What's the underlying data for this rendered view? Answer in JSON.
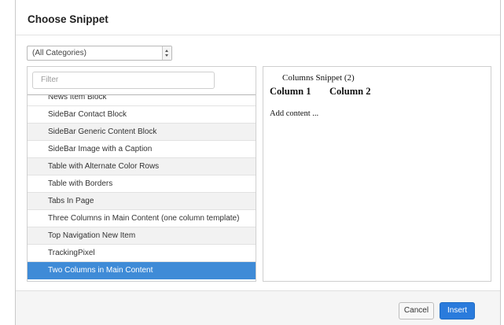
{
  "dialog": {
    "title": "Choose Snippet"
  },
  "category_select": {
    "value": "(All Categories)"
  },
  "filter": {
    "placeholder": "Filter"
  },
  "snippets": [
    {
      "label": "News Item Block"
    },
    {
      "label": "SideBar Contact Block"
    },
    {
      "label": "SideBar Generic Content Block"
    },
    {
      "label": "SideBar Image with a Caption"
    },
    {
      "label": "Table with Alternate Color Rows"
    },
    {
      "label": "Table with Borders"
    },
    {
      "label": "Tabs In Page"
    },
    {
      "label": "Three Columns in Main Content (one column template)"
    },
    {
      "label": "Top Navigation New Item"
    },
    {
      "label": "TrackingPixel"
    },
    {
      "label": "Two Columns in Main Content"
    }
  ],
  "selected_snippet": "Two Columns in Main Content",
  "preview": {
    "caption": "Columns Snippet (2)",
    "column1": "Column 1",
    "column2": "Column 2",
    "body": "Add content ..."
  },
  "footer": {
    "cancel_label": "Cancel",
    "insert_label": "Insert"
  },
  "colors": {
    "selection": "#3f8bd7",
    "primary_button": "#2a7bdc"
  }
}
